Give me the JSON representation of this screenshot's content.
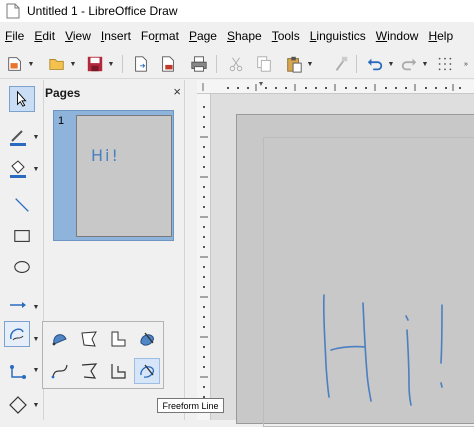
{
  "window": {
    "title": "Untitled 1 - LibreOffice Draw"
  },
  "menu": {
    "items": [
      {
        "label": "File",
        "key": "F",
        "rest": "ile"
      },
      {
        "label": "Edit",
        "key": "E",
        "rest": "dit"
      },
      {
        "label": "View",
        "key": "V",
        "rest": "iew"
      },
      {
        "label": "Insert",
        "key": "I",
        "rest": "nsert"
      },
      {
        "label": "Format",
        "key": "r",
        "pre": "Fo",
        "rest": "mat"
      },
      {
        "label": "Page",
        "key": "P",
        "rest": "age"
      },
      {
        "label": "Shape",
        "key": "S",
        "rest": "hape"
      },
      {
        "label": "Tools",
        "key": "T",
        "rest": "ools"
      },
      {
        "label": "Linguistics",
        "key": "L",
        "rest": "inguistics"
      },
      {
        "label": "Window",
        "key": "W",
        "rest": "indow"
      },
      {
        "label": "Help",
        "key": "H",
        "rest": "elp"
      }
    ]
  },
  "toolbar": {
    "icons": [
      "new-icon",
      "open-icon",
      "save-icon",
      "export-icon",
      "export-pdf-icon",
      "print-icon",
      "cut-icon",
      "copy-icon",
      "paste-icon",
      "clone-formatting-icon",
      "undo-icon",
      "redo-icon",
      "grid-icon",
      "overflow-icon"
    ]
  },
  "left_toolbar": {
    "icons": [
      "select-icon",
      "line-color-icon",
      "fill-color-icon",
      "line-icon",
      "rectangle-icon",
      "ellipse-icon",
      "arrow-line-icon",
      "curves-polygons-icon",
      "connector-icon",
      "basic-shapes-icon"
    ]
  },
  "pages_panel": {
    "title": "Pages",
    "close": "×",
    "thumbnails": [
      {
        "number": "1",
        "text": "Hi!"
      }
    ]
  },
  "flyout": {
    "icons": [
      "curve-filled-icon",
      "polygon-filled-icon",
      "polygon-45-filled-icon",
      "freeform-filled-icon",
      "curve-icon",
      "polygon-icon",
      "polygon-45-icon",
      "freeform-line-icon"
    ]
  },
  "tooltip": {
    "text": "Freeform Line"
  },
  "colors": {
    "accent": "#2a6bbf",
    "selected_thumb": "#8fb4dc",
    "page": "#c8c8c8",
    "ink": "#4a7fc0",
    "save_red": "#b4283c"
  }
}
